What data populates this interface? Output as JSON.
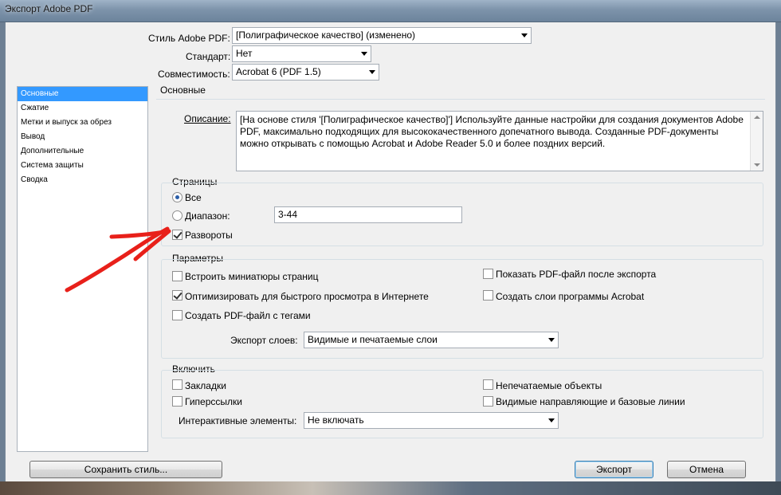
{
  "window": {
    "title": "Экспорт Adobe PDF"
  },
  "top": {
    "style_label": "Стиль Adobe PDF:",
    "style_value": "[Полиграфическое качество] (изменено)",
    "standard_label": "Стандарт:",
    "standard_value": "Нет",
    "compat_label": "Совместимость:",
    "compat_value": "Acrobat 6 (PDF 1.5)"
  },
  "sidebar": {
    "items": [
      {
        "label": "Основные",
        "active": true
      },
      {
        "label": "Сжатие"
      },
      {
        "label": "Метки и выпуск за обрез"
      },
      {
        "label": "Вывод"
      },
      {
        "label": "Дополнительные"
      },
      {
        "label": "Система защиты"
      },
      {
        "label": "Сводка"
      }
    ]
  },
  "main": {
    "section_title": "Основные",
    "description_label": "Описание:",
    "description_text": "[На основе стиля '[Полиграфическое качество]'] Используйте данные настройки для создания документов Adobe PDF, максимально подходящих для высококачественного допечатного вывода.  Созданные PDF-документы можно открывать с помощью Acrobat и Adobe Reader 5.0 и более поздних версий.",
    "pages": {
      "title": "Страницы",
      "all_label": "Все",
      "range_label": "Диапазон:",
      "range_value": "3-44",
      "spreads_label": "Развороты"
    },
    "params": {
      "title": "Параметры",
      "embed_thumbs": "Встроить миниатюры страниц",
      "optimize_web": "Оптимизировать для быстрого просмотра в Интернете",
      "tagged_pdf": "Создать PDF-файл с тегами",
      "show_after": "Показать PDF-файл после экспорта",
      "acrobat_layers": "Создать слои программы Acrobat",
      "export_layers_label": "Экспорт слоев:",
      "export_layers_value": "Видимые и печатаемые слои"
    },
    "include": {
      "title": "Включить",
      "bookmarks": "Закладки",
      "hyperlinks": "Гиперссылки",
      "nonprinting": "Непечатаемые объекты",
      "guides": "Видимые направляющие и базовые линии",
      "interactive_label": "Интерактивные элементы:",
      "interactive_value": "Не включать"
    }
  },
  "buttons": {
    "save_style": "Сохранить стиль...",
    "export": "Экспорт",
    "cancel": "Отмена"
  },
  "annotation": {
    "arrow_color": "#e8201a"
  }
}
